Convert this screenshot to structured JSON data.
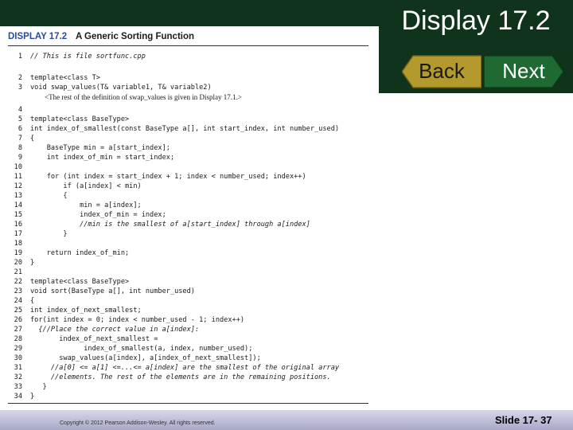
{
  "slide": {
    "title": "Display 17.2",
    "back_label": "Back",
    "next_label": "Next",
    "copyright": "Copyright © 2012 Pearson Addison-Wesley. All rights reserved.",
    "slide_number": "Slide 17- 37"
  },
  "display": {
    "number": "DISPLAY 17.2",
    "caption": "A Generic Sorting Function"
  },
  "colors": {
    "dark_green": "#10331b",
    "keyword_blue": "#2b4aa0",
    "button_gold": "#b49a2c",
    "button_green": "#1f6a33",
    "footer_lavender": "#c4c4e0"
  },
  "code_lines": [
    {
      "n": "1",
      "t": "// This is file sortfunc.cpp",
      "c": true
    },
    {
      "n": "2",
      "t": "template<class T>"
    },
    {
      "n": "3",
      "t": "void swap_values(T& variable1, T& variable2)"
    },
    {
      "n": "",
      "t": "        <The rest of the definition of swap_values is given in Display 17.1.>",
      "note": true
    },
    {
      "n": "4",
      "t": ""
    },
    {
      "n": "5",
      "t": "template<class BaseType>"
    },
    {
      "n": "6",
      "t": "int index_of_smallest(const BaseType a[], int start_index, int number_used)"
    },
    {
      "n": "7",
      "t": "{"
    },
    {
      "n": "8",
      "t": "    BaseType min = a[start_index];"
    },
    {
      "n": "9",
      "t": "    int index_of_min = start_index;"
    },
    {
      "n": "10",
      "t": ""
    },
    {
      "n": "11",
      "t": "    for (int index = start_index + 1; index < number_used; index++)"
    },
    {
      "n": "12",
      "t": "        if (a[index] < min)"
    },
    {
      "n": "13",
      "t": "        {"
    },
    {
      "n": "14",
      "t": "            min = a[index];"
    },
    {
      "n": "15",
      "t": "            index_of_min = index;"
    },
    {
      "n": "16",
      "t": "            //min is the smallest of a[start_index] through a[index]",
      "c": true
    },
    {
      "n": "17",
      "t": "        }"
    },
    {
      "n": "18",
      "t": ""
    },
    {
      "n": "19",
      "t": "    return index_of_min;"
    },
    {
      "n": "20",
      "t": "}"
    },
    {
      "n": "21",
      "t": ""
    },
    {
      "n": "22",
      "t": "template<class BaseType>"
    },
    {
      "n": "23",
      "t": "void sort(BaseType a[], int number_used)"
    },
    {
      "n": "24",
      "t": "{"
    },
    {
      "n": "25",
      "t": "int index_of_next_smallest;"
    },
    {
      "n": "26",
      "t": "for(int index = 0; index < number_used - 1; index++)"
    },
    {
      "n": "27",
      "t": "  {//Place the correct value in a[index]:",
      "c": true
    },
    {
      "n": "28",
      "t": "       index_of_next_smallest ="
    },
    {
      "n": "29",
      "t": "             index_of_smallest(a, index, number_used);"
    },
    {
      "n": "30",
      "t": "       swap_values(a[index], a[index_of_next_smallest]);"
    },
    {
      "n": "31",
      "t": "     //a[0] <= a[1] <=...<= a[index] are the smallest of the original array",
      "c": true
    },
    {
      "n": "32",
      "t": "     //elements. The rest of the elements are in the remaining positions.",
      "c": true
    },
    {
      "n": "33",
      "t": "   }"
    },
    {
      "n": "34",
      "t": "}"
    }
  ]
}
